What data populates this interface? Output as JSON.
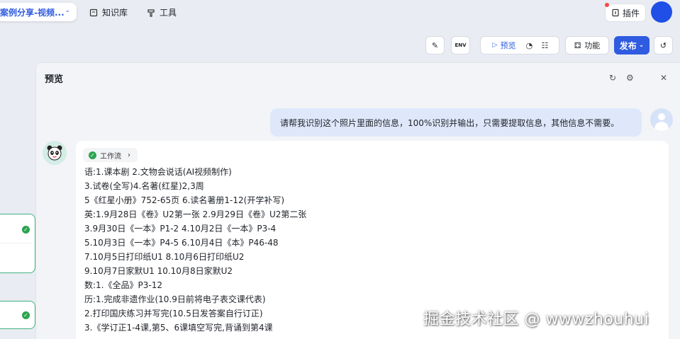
{
  "topnav": {
    "app_title": "案例分享-视频...",
    "links": [
      {
        "label": "知识库",
        "icon": "book-icon"
      },
      {
        "label": "工具",
        "icon": "tool-icon"
      }
    ],
    "plugin_label": "插件"
  },
  "toolbar": {
    "preview_label": "预览",
    "features_label": "功能",
    "publish_label": "发布"
  },
  "panel": {
    "title": "预览",
    "user_message": "请帮我识别这个照片里面的信息，100%识别并输出，只需要提取信息，其他信息不需要。",
    "workflow_chip": "工作流",
    "response_lines": [
      "语:1.课本剧 2.文物会说话(AI视频制作)",
      "3.试卷(全写)4.名著(红星)2,3周",
      "5《红星小册》752-65页 6.读名著册1-12(开学补写)",
      "英:1.9月28日《卷》U2第一张 2.9月29日《卷》U2第二张",
      "3.9月30日《一本》P1-2 4.10月2日《一本》P3-4",
      "5.10月3日《一本》P4-5 6.10月4日《本》P46-48",
      "7.10月5日打印纸U1 8.10月6日打印纸U2",
      "9.10月7日家默U1 10.10月8日家默U2",
      "数:1.《全品》P3-12",
      "历:1.完成非遗作业(10.9日前将电子表交课代表)",
      "2.打印国庆练习并写完(10.5日发答案自行订正)",
      "3.《学订正1-4课,第5、6课填空写完,背诵到第4课"
    ]
  },
  "watermark": "掘金技术社区 @ wwwzhouhui",
  "colors": {
    "accent": "#2f5be0",
    "success": "#2aa44f",
    "user_bubble": "#dfe8fb",
    "canvas_bg": "#e9ecf3"
  }
}
